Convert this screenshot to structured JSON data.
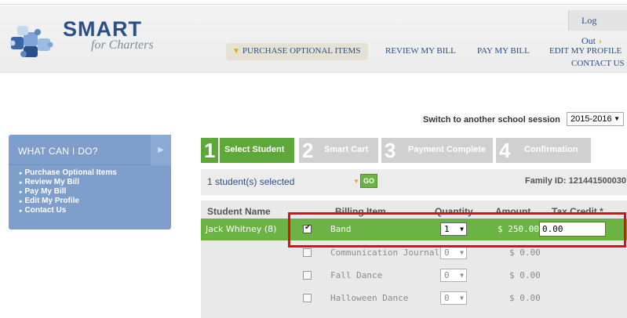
{
  "header": {
    "logo": {
      "brand": "SMART",
      "tagline": "for Charters"
    },
    "logout": "Log Out",
    "nav": {
      "purchase": "PURCHASE OPTIONAL ITEMS",
      "review": "REVIEW MY BILL",
      "pay": "PAY MY BILL",
      "edit": "EDIT MY PROFILE",
      "contact": "CONTACT US"
    }
  },
  "session": {
    "label": "Switch to another school session",
    "value": "2015-2016"
  },
  "sidebar": {
    "title": "WHAT CAN I DO?",
    "items": [
      "Purchase Optional Items",
      "Review My Bill",
      "Pay My Bill",
      "Edit My Profile",
      "Contact Us"
    ]
  },
  "steps": [
    {
      "num": "1",
      "label": "Select Student",
      "active": true
    },
    {
      "num": "2",
      "label": "Smart Cart",
      "active": false
    },
    {
      "num": "3",
      "label": "Payment Complete",
      "active": false
    },
    {
      "num": "4",
      "label": "Confirmation",
      "active": false
    }
  ],
  "student_bar": {
    "selected": "1 student(s) selected",
    "go": "GO",
    "family_id": "Family ID: 121441500030"
  },
  "table": {
    "headers": {
      "student": "Student Name",
      "item": "Billing Item",
      "qty": "Quantity",
      "amount": "Amount",
      "tax": "Tax Credit *"
    },
    "rows": [
      {
        "student": "Jack Whitney (8)",
        "checked": true,
        "item": "Band",
        "qty": "1",
        "amount": "$ 250.00",
        "tax": "0.00"
      },
      {
        "student": "",
        "checked": false,
        "item": "Communication Journal",
        "qty": "0",
        "amount": "$ 0.00",
        "tax": ""
      },
      {
        "student": "",
        "checked": false,
        "item": "Fall Dance",
        "qty": "0",
        "amount": "$ 0.00",
        "tax": ""
      },
      {
        "student": "",
        "checked": false,
        "item": "Halloween Dance",
        "qty": "0",
        "amount": "$ 0.00",
        "tax": ""
      }
    ]
  },
  "colors": {
    "brand_blue": "#2a4f8a",
    "accent_green": "#6bb344",
    "highlight_red": "#e01010",
    "sidebar_blue": "#7e9fcc"
  }
}
